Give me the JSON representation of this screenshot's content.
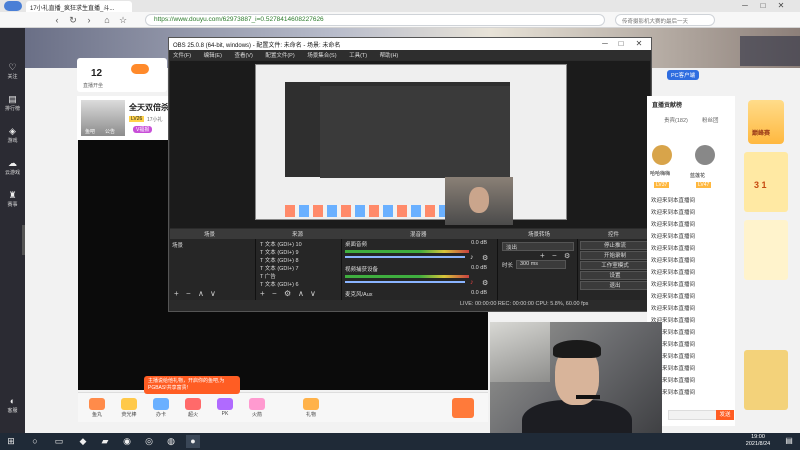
{
  "browser": {
    "tab_title": "17小礼直播_疯狂求生直播_斗...",
    "url": "https://www.douyu.com/62973887_i=0.52784146082​27626",
    "search_placeholder": "传奇摄影机大赛的最后一天"
  },
  "sidebar": {
    "items": [
      {
        "label": "关注"
      },
      {
        "label": "排行榜"
      },
      {
        "label": "游戏"
      },
      {
        "label": "云游戏"
      },
      {
        "label": "赛事"
      },
      {
        "label": "客服"
      }
    ]
  },
  "room": {
    "follower_count": "12",
    "follower_label": "直播开坐",
    "title": "全天双倍杀",
    "level_badge": "LV26",
    "tag_text": "17小礼",
    "sub_tag": "V福报",
    "nickname": "鱼吧",
    "notice": "公告"
  },
  "obs": {
    "title": "OBS 25.0.8 (64-bit, windows) - 配置文件: 未命名 - 场景: 未命名",
    "menu": [
      "文件(F)",
      "编辑(E)",
      "查看(V)",
      "配置文件(P)",
      "场景集合(S)",
      "工具(T)",
      "帮助(H)"
    ],
    "docks": [
      "场景",
      "来源",
      "混音器",
      "场景转场",
      "控件"
    ],
    "scene": "场景",
    "sources": [
      "文本 (GDI+) 10",
      "文本 (GDI+) 9",
      "文本 (GDI+) 8",
      "文本 (GDI+) 7",
      "广告",
      "文本 (GDI+) 6"
    ],
    "mixer": [
      {
        "name": "桌面音频",
        "level": "0.0 dB"
      },
      {
        "name": "视频捕获设备",
        "level": "0.0 dB"
      },
      {
        "name": "麦克风/Aux",
        "level": "0.0 dB"
      }
    ],
    "transition": "淡出",
    "duration_label": "时长",
    "duration_value": "300 ms",
    "controls": [
      "停止推流",
      "开始录制",
      "工作室模式",
      "设置",
      "退出"
    ],
    "status": "LIVE: 00:00:00   REC: 00:00:00   CPU: 5.8%, 60.00 fps"
  },
  "gifts": [
    "鱼丸",
    "荧光棒",
    "办卡",
    "超火",
    "PK",
    "火箭",
    "礼物"
  ],
  "tooltip": "主播说给他礼物，开启你的鱼吧,为PGBAS!共享富贵!",
  "chat": {
    "tabs": [
      "贵宾(182)",
      "粉丝团"
    ],
    "rank_label": "直播贡献榜",
    "users": [
      {
        "name": "哈哈嗨嗨",
        "level": "LV37"
      },
      {
        "name": "蓝莲花",
        "level": "LV47"
      }
    ],
    "lines": [
      {
        "user": "",
        "text": "欢迎来到本直播间"
      },
      {
        "user": "",
        "text": "欢迎来到本直播间"
      },
      {
        "user": "",
        "text": "欢迎来到本直播间"
      },
      {
        "user": "",
        "text": "欢迎来到本直播间"
      },
      {
        "user": "",
        "text": "欢迎来到本直播间"
      },
      {
        "user": "",
        "text": "欢迎来到本直播间"
      },
      {
        "user": "",
        "text": "欢迎来到本直播间"
      },
      {
        "user": "",
        "text": "欢迎来到本直播间"
      },
      {
        "user": "",
        "text": "欢迎来到本直播间"
      },
      {
        "user": "",
        "text": "欢迎来到本直播间"
      },
      {
        "user": "",
        "text": "欢迎来到本直播间"
      },
      {
        "user": "",
        "text": "欢迎来到本直播间"
      },
      {
        "user": "",
        "text": "欢迎来到本直播间"
      },
      {
        "user": "",
        "text": "欢迎来到本直播间"
      },
      {
        "user": "",
        "text": "欢迎来到本直播间"
      },
      {
        "user": "",
        "text": "欢迎来到本直播间"
      },
      {
        "user": "",
        "text": "欢迎来到本直播间"
      }
    ],
    "send_label": "发送"
  },
  "right_ads": {
    "rank_card": "巅峰赛",
    "pc_client": "PC客户端",
    "gift_card": "3 1"
  },
  "taskbar": {
    "time": "19:00",
    "date": "2021/8/24"
  }
}
